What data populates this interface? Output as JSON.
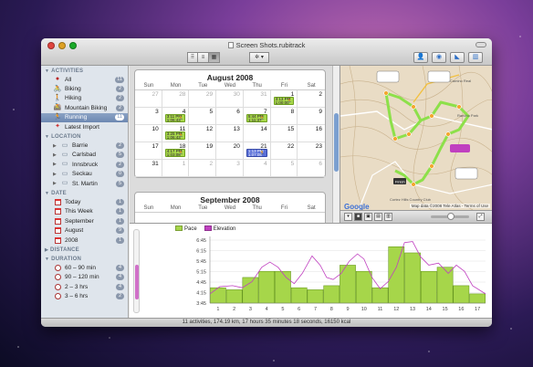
{
  "window": {
    "title": "Screen Shots.rubitrack",
    "status": "11 activities, 174.19 km, 17 hours 35 minutes 18 seconds, 16150 kcal"
  },
  "colors": {
    "pace_fill": "#a6d64a",
    "pace_stroke": "#5c8f12",
    "elevation": "#c040c0",
    "selection": "#6d88b2",
    "event": "#a8d84a",
    "event_blue": "#5a70d8"
  },
  "toolbar": {
    "view_buttons": [
      "⠿",
      "≡",
      "▦"
    ],
    "action_label": "✲ ▾",
    "right_buttons": [
      "👤",
      "◉",
      "◣",
      "▥"
    ]
  },
  "sidebar": {
    "activities_header": "ACTIVITIES",
    "activities": [
      {
        "label": "All",
        "icon": "all-icon",
        "glyph": "●",
        "count": "11"
      },
      {
        "label": "Biking",
        "icon": "biking-icon",
        "glyph": "🚴",
        "count": "2"
      },
      {
        "label": "Hiking",
        "icon": "hiking-icon",
        "glyph": "🚶",
        "count": "2"
      },
      {
        "label": "Mountain Biking",
        "icon": "mountain-biking-icon",
        "glyph": "🚵",
        "count": "2"
      },
      {
        "label": "Running",
        "icon": "running-icon",
        "glyph": "🏃",
        "count": "11"
      },
      {
        "label": "Latest Import",
        "icon": "import-icon",
        "glyph": "✦",
        "count": ""
      }
    ],
    "location_header": "LOCATION",
    "locations": [
      {
        "label": "Barrie",
        "count": "2"
      },
      {
        "label": "Carlsbad",
        "count": "5"
      },
      {
        "label": "Innsbruck",
        "count": "2"
      },
      {
        "label": "Seckau",
        "count": "0"
      },
      {
        "label": "St. Martin",
        "count": "5"
      }
    ],
    "date_header": "DATE",
    "dates": [
      {
        "label": "Today",
        "count": "1"
      },
      {
        "label": "This Week",
        "count": "1"
      },
      {
        "label": "September",
        "count": "1"
      },
      {
        "label": "August",
        "count": "9"
      },
      {
        "label": "2008",
        "count": "1"
      }
    ],
    "distance_header": "DISTANCE",
    "duration_header": "DURATION",
    "durations": [
      {
        "label": "60 – 90 min",
        "count": "4"
      },
      {
        "label": "90 – 120 min",
        "count": "4"
      },
      {
        "label": "2 – 3 hrs",
        "count": "4"
      },
      {
        "label": "3 – 6 hrs",
        "count": "2"
      }
    ]
  },
  "calendar": {
    "weekdays": [
      "Sun",
      "Mon",
      "Tue",
      "Wed",
      "Thu",
      "Fri",
      "Sat"
    ],
    "august": {
      "title": "August 2008",
      "days": [
        {
          "n": "27",
          "m": true
        },
        {
          "n": "28",
          "m": true
        },
        {
          "n": "29",
          "m": true
        },
        {
          "n": "30",
          "m": true
        },
        {
          "n": "31",
          "m": true
        },
        {
          "n": "1",
          "ev": "3:13 PM\n1:00:00"
        },
        {
          "n": "2"
        },
        {
          "n": "3"
        },
        {
          "n": "4",
          "ev": "3:11 PM\n1:06:43"
        },
        {
          "n": "5"
        },
        {
          "n": "6"
        },
        {
          "n": "7",
          "ev": "5:44 PM\n1:11:37"
        },
        {
          "n": "8"
        },
        {
          "n": "9"
        },
        {
          "n": "10"
        },
        {
          "n": "11",
          "ev": "3:25 PM\n1:06:43"
        },
        {
          "n": "12"
        },
        {
          "n": "13"
        },
        {
          "n": "14"
        },
        {
          "n": "15"
        },
        {
          "n": "16"
        },
        {
          "n": "17"
        },
        {
          "n": "18",
          "ev": "4:17 PM\n1:03:08"
        },
        {
          "n": "19"
        },
        {
          "n": "20"
        },
        {
          "n": "21",
          "ev": "1:13 PM\n1:07:08",
          "blue": true
        },
        {
          "n": "22"
        },
        {
          "n": "23"
        },
        {
          "n": "31"
        },
        {
          "n": "1",
          "m": true
        },
        {
          "n": "2",
          "m": true
        },
        {
          "n": "3",
          "m": true
        },
        {
          "n": "4",
          "m": true
        },
        {
          "n": "5",
          "m": true
        },
        {
          "n": "6",
          "m": true
        }
      ]
    },
    "september": {
      "title": "September 2008"
    }
  },
  "map": {
    "attribution": "Map data ©2008 Tele Atlas - Terms of Use",
    "logo": "Google",
    "labels": [
      "Finish",
      "Cortez Hills Country Club",
      "Rancho Park",
      "Camino Real"
    ]
  },
  "chart_data": {
    "type": "bar",
    "legend": [
      "Pace",
      "Elevation"
    ],
    "y_ticks": [
      "6:45",
      "6:15",
      "5:45",
      "5:15",
      "4:45",
      "4:15",
      "3:45"
    ],
    "x_ticks": [
      "1",
      "2",
      "3",
      "4",
      "5",
      "6",
      "7",
      "8",
      "9",
      "10",
      "11",
      "12",
      "13",
      "14",
      "15",
      "16",
      "17"
    ],
    "x": [
      0.5,
      1.5,
      2.5,
      3.5,
      4.5,
      5.5,
      6.5,
      7.5,
      8.5,
      9.5,
      10.5,
      11.5,
      12.5,
      13.5,
      14.5,
      15.5,
      16.5
    ],
    "pace": [
      4.5,
      4.4,
      5.0,
      5.3,
      5.3,
      4.5,
      4.4,
      4.6,
      5.6,
      5.3,
      4.5,
      6.5,
      6.2,
      5.3,
      5.5,
      4.6,
      4.2
    ],
    "elevation": [
      [
        0,
        4.2
      ],
      [
        0.6,
        4.55
      ],
      [
        1.4,
        4.6
      ],
      [
        2.0,
        4.5
      ],
      [
        2.6,
        4.8
      ],
      [
        3.2,
        5.5
      ],
      [
        3.7,
        5.75
      ],
      [
        4.2,
        5.5
      ],
      [
        4.7,
        5.0
      ],
      [
        5.2,
        4.7
      ],
      [
        5.7,
        5.2
      ],
      [
        6.3,
        6.05
      ],
      [
        6.8,
        5.6
      ],
      [
        7.2,
        5.0
      ],
      [
        7.6,
        4.9
      ],
      [
        8.1,
        5.2
      ],
      [
        8.6,
        5.8
      ],
      [
        9.1,
        6.15
      ],
      [
        9.5,
        5.9
      ],
      [
        10.0,
        5.0
      ],
      [
        10.5,
        4.45
      ],
      [
        11.0,
        4.8
      ],
      [
        11.5,
        5.5
      ],
      [
        12.0,
        6.7
      ],
      [
        12.5,
        6.75
      ],
      [
        13.0,
        6.0
      ],
      [
        13.5,
        5.6
      ],
      [
        14.1,
        5.7
      ],
      [
        14.7,
        5.2
      ],
      [
        15.2,
        5.6
      ],
      [
        15.7,
        5.3
      ],
      [
        16.2,
        4.6
      ],
      [
        17,
        4.2
      ]
    ],
    "ylim": [
      3.75,
      7.0
    ],
    "xlim": [
      0,
      17
    ]
  }
}
